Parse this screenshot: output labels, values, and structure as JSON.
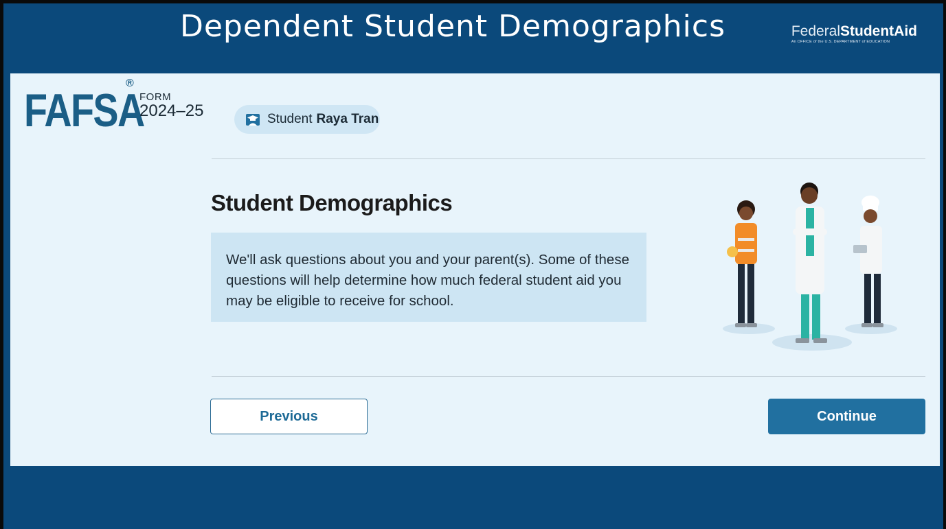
{
  "slide": {
    "title": "Dependent Student Demographics",
    "logo": {
      "light": "Federal",
      "bold": "StudentAid",
      "tagline": "An OFFICE of the U.S. DEPARTMENT of EDUCATION"
    }
  },
  "app": {
    "brand": "FAFSA",
    "registered": "®",
    "form_label": "FORM",
    "form_year": "2024–25",
    "student_pill": {
      "icon": "graduation-cap-person-icon",
      "role": "Student",
      "name": "Raya Tran"
    }
  },
  "main": {
    "heading": "Student Demographics",
    "info_text": "We'll ask questions about you and your parent(s). Some of these questions will help determine how much federal student aid you may be eligible to receive for school.",
    "illustration": "three-workers-illustration"
  },
  "nav": {
    "previous_label": "Previous",
    "continue_label": "Continue"
  },
  "colors": {
    "slide_background": "#0b497b",
    "brand_blue": "#1b5e86",
    "continue_button": "#2170a0",
    "info_box": "#cde5f3"
  }
}
